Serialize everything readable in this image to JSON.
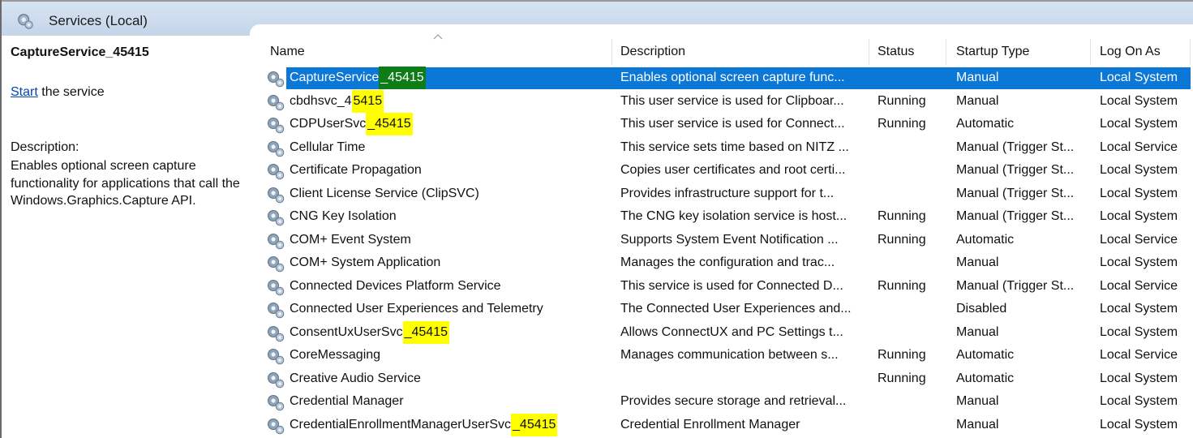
{
  "window": {
    "title": "Services (Local)"
  },
  "details": {
    "service_name": "CaptureService_45415",
    "start_link": "Start",
    "start_suffix": " the service",
    "description_label": "Description:",
    "description": "Enables optional screen capture functionality for applications that call the Windows.Graphics.Capture API."
  },
  "columns": {
    "name": "Name",
    "description": "Description",
    "status": "Status",
    "startup_type": "Startup Type",
    "log_on_as": "Log On As"
  },
  "colors": {
    "selection": "#0b78d7",
    "highlight": "#ffff00",
    "selected_highlight": "#0e7d17"
  },
  "rows": [
    {
      "name_prefix": "CaptureService",
      "name_hl": "_45415",
      "description": "Enables optional screen capture func...",
      "status": "",
      "startup": "Manual",
      "logon": "Local System",
      "selected": true
    },
    {
      "name_prefix": "cbdhsvc_4",
      "name_hl": "5415",
      "description": "This user service is used for Clipboar...",
      "status": "Running",
      "startup": "Manual",
      "logon": "Local System"
    },
    {
      "name_prefix": "CDPUserSvc",
      "name_hl": "_45415",
      "description": "This user service is used for Connect...",
      "status": "Running",
      "startup": "Automatic",
      "logon": "Local System"
    },
    {
      "name_prefix": "Cellular Time",
      "name_hl": "",
      "description": "This service sets time based on NITZ ...",
      "status": "",
      "startup": "Manual (Trigger St...",
      "logon": "Local Service"
    },
    {
      "name_prefix": "Certificate Propagation",
      "name_hl": "",
      "description": "Copies user certificates and root certi...",
      "status": "",
      "startup": "Manual (Trigger St...",
      "logon": "Local System"
    },
    {
      "name_prefix": "Client License Service (ClipSVC)",
      "name_hl": "",
      "description": "Provides infrastructure support for t...",
      "status": "",
      "startup": "Manual (Trigger St...",
      "logon": "Local System"
    },
    {
      "name_prefix": "CNG Key Isolation",
      "name_hl": "",
      "description": "The CNG key isolation service is host...",
      "status": "Running",
      "startup": "Manual (Trigger St...",
      "logon": "Local System"
    },
    {
      "name_prefix": "COM+ Event System",
      "name_hl": "",
      "description": "Supports System Event Notification ...",
      "status": "Running",
      "startup": "Automatic",
      "logon": "Local Service"
    },
    {
      "name_prefix": "COM+ System Application",
      "name_hl": "",
      "description": "Manages the configuration and trac...",
      "status": "",
      "startup": "Manual",
      "logon": "Local System"
    },
    {
      "name_prefix": "Connected Devices Platform Service",
      "name_hl": "",
      "description": "This service is used for Connected D...",
      "status": "Running",
      "startup": "Manual (Trigger St...",
      "logon": "Local Service"
    },
    {
      "name_prefix": "Connected User Experiences and Telemetry",
      "name_hl": "",
      "description": "The Connected User Experiences and...",
      "status": "",
      "startup": "Disabled",
      "logon": "Local System"
    },
    {
      "name_prefix": "ConsentUxUserSvc",
      "name_hl": "_45415",
      "description": "Allows ConnectUX and PC Settings t...",
      "status": "",
      "startup": "Manual",
      "logon": "Local System"
    },
    {
      "name_prefix": "CoreMessaging",
      "name_hl": "",
      "description": "Manages communication between s...",
      "status": "Running",
      "startup": "Automatic",
      "logon": "Local Service"
    },
    {
      "name_prefix": "Creative Audio Service",
      "name_hl": "",
      "description": "",
      "status": "Running",
      "startup": "Automatic",
      "logon": "Local System"
    },
    {
      "name_prefix": "Credential Manager",
      "name_hl": "",
      "description": "Provides secure storage and retrieval...",
      "status": "",
      "startup": "Manual",
      "logon": "Local System"
    },
    {
      "name_prefix": "CredentialEnrollmentManagerUserSvc",
      "name_hl": "_45415",
      "description": "Credential Enrollment Manager",
      "status": "",
      "startup": "Manual",
      "logon": "Local System"
    }
  ]
}
